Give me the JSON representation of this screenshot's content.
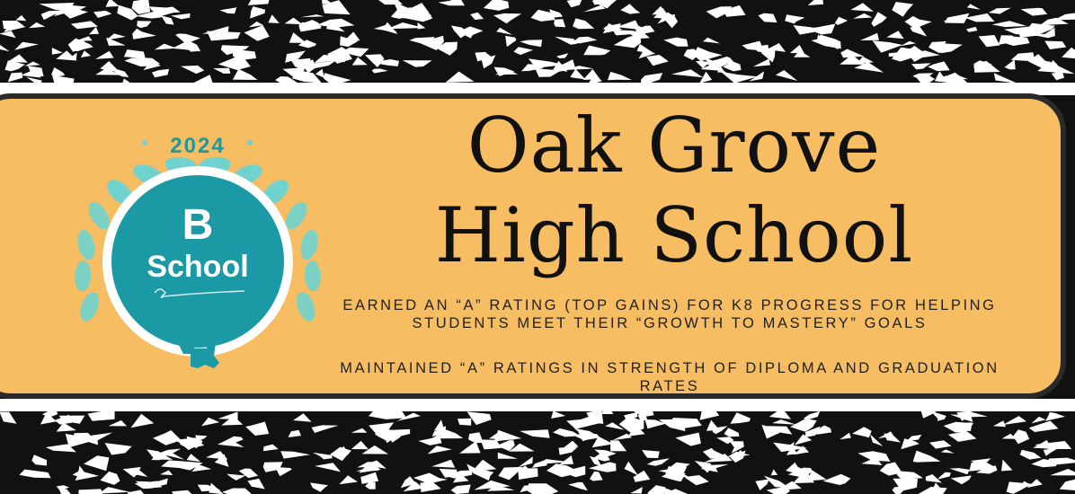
{
  "badge": {
    "year": "2024",
    "grade": "B",
    "label": "School",
    "colors": {
      "teal": "#1b9aa6",
      "leaf": "#6fd1cf",
      "year_text": "#1b9aa6"
    },
    "icons": [
      "laurel-wreath-icon",
      "louisiana-state-icon"
    ]
  },
  "title": {
    "line1": "Oak Grove",
    "line2": "High School"
  },
  "description": {
    "line1": "Earned an “A” rating (Top Gains) for K8 Progress for helping students meet their “Growth to Mastery” goals",
    "line2": "Maintained “A” ratings in Strength of Diploma and Graduation Rates"
  },
  "colors": {
    "banner": "#f7bd62",
    "border": "#2a2a2a",
    "marble": "#111111"
  }
}
